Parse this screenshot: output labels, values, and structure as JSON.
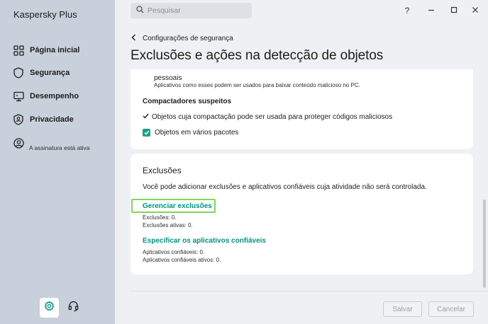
{
  "app": {
    "brand": "Kaspersky Plus"
  },
  "search": {
    "placeholder": "Pesquisar"
  },
  "window": {
    "help": "?",
    "minimize": "—",
    "maximize": "☐",
    "close": "✕"
  },
  "sidebar": {
    "items": [
      {
        "label": "Página inicial",
        "icon": "home-grid-icon"
      },
      {
        "label": "Segurança",
        "icon": "shield-icon"
      },
      {
        "label": "Desempenho",
        "icon": "monitor-icon"
      },
      {
        "label": "Privacidade",
        "icon": "privacy-shield-icon"
      }
    ],
    "account_icon": "user-icon",
    "subscription_status": "A assinatura está ativa",
    "settings_icon": "gear-icon",
    "support_icon": "headset-icon"
  },
  "header": {
    "breadcrumb": "Configurações de segurança",
    "title": "Exclusões e ações na detecção de objetos"
  },
  "card1": {
    "personal_label": "pessoais",
    "personal_desc": "Aplicativos como esses podem ser usados para baixar conteúdo malicioso no PC.",
    "packers_heading": "Compactadores suspeitos",
    "packers_option1": "Objetos cuja compactação pode ser usada para proteger códigos maliciosos",
    "packers_option2": "Objetos em vários pacotes"
  },
  "card2": {
    "title": "Exclusões",
    "description": "Você pode adicionar exclusões e aplicativos confiáveis cuja atividade não será controlada.",
    "manage_link": "Gerenciar exclusões",
    "exclusions_count": "Exclusões: 0.",
    "active_exclusions": "Exclusões ativas: 0.",
    "trusted_link": "Especificar os aplicativos confiáveis",
    "trusted_count": "Aplicativos confiáveis: 0.",
    "active_trusted": "Aplicativos confiáveis ativos: 0."
  },
  "footer": {
    "save": "Salvar",
    "cancel": "Cancelar"
  },
  "colors": {
    "accent": "#00927e",
    "checkbox": "#1a9e8a",
    "highlight": "#7ed957",
    "sidebar": "#c8d0db"
  }
}
